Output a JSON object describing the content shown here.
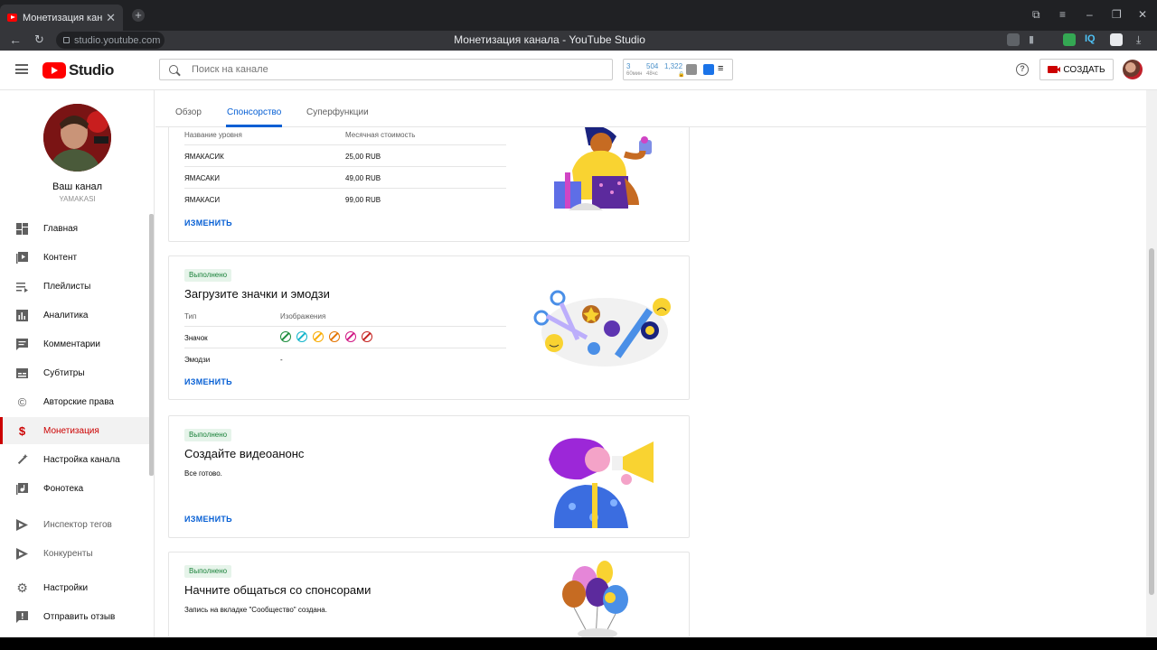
{
  "browser": {
    "tab_title": "Монетизация канала -",
    "page_title": "Монетизация канала - YouTube Studio",
    "url": "studio.youtube.com"
  },
  "header": {
    "logo_text": "Studio",
    "search_placeholder": "Поиск на канале",
    "stats": {
      "v1": "3",
      "l1": "60мин",
      "v2": "504",
      "l2": "48чс",
      "v3": "1,322"
    },
    "create_label": "СОЗДАТЬ"
  },
  "sidebar": {
    "channel_label": "Ваш канал",
    "channel_name": "YAMAKASI",
    "items": [
      {
        "label": "Главная",
        "icon": "dashboard-icon"
      },
      {
        "label": "Контент",
        "icon": "video-library-icon"
      },
      {
        "label": "Плейлисты",
        "icon": "playlist-icon"
      },
      {
        "label": "Аналитика",
        "icon": "analytics-icon"
      },
      {
        "label": "Комментарии",
        "icon": "comment-icon"
      },
      {
        "label": "Субтитры",
        "icon": "subtitles-icon"
      },
      {
        "label": "Авторские права",
        "icon": "copyright-icon"
      },
      {
        "label": "Монетизация",
        "icon": "dollar-icon"
      },
      {
        "label": "Настройка канала",
        "icon": "magic-wand-icon"
      },
      {
        "label": "Фонотека",
        "icon": "audio-library-icon"
      },
      {
        "label": "Инспектор тегов",
        "icon": "tag-inspector-icon"
      },
      {
        "label": "Конкуренты",
        "icon": "competitors-icon"
      },
      {
        "label": "Настройки",
        "icon": "gear-icon"
      },
      {
        "label": "Отправить отзыв",
        "icon": "feedback-icon"
      }
    ]
  },
  "tabs": [
    {
      "label": "Обзор"
    },
    {
      "label": "Спонсорство"
    },
    {
      "label": "Суперфункции"
    }
  ],
  "card_levels": {
    "col1": "Название уровня",
    "col2": "Месячная стоимость",
    "rows": [
      {
        "name": "ЯМАКАСИК",
        "price": "25,00 RUB"
      },
      {
        "name": "ЯМАСАКИ",
        "price": "49,00 RUB"
      },
      {
        "name": "ЯМАКАСИ",
        "price": "99,00 RUB"
      }
    ],
    "link": "ИЗМЕНИТЬ"
  },
  "card_badges": {
    "badge": "Выполнено",
    "title": "Загрузите значки и эмодзи",
    "col1": "Тип",
    "col2": "Изображения",
    "row1_label": "Значок",
    "row2_label": "Эмодзи",
    "row2_value": "-",
    "emoji_colors": [
      "#1e8e3e",
      "#12b5cb",
      "#f9ab00",
      "#e37400",
      "#d01884",
      "#c5221f"
    ],
    "link": "ИЗМЕНИТЬ"
  },
  "card_trailer": {
    "badge": "Выполнено",
    "title": "Создайте видеоанонс",
    "desc": "Все готово.",
    "link": "ИЗМЕНИТЬ"
  },
  "card_community": {
    "badge": "Выполнено",
    "title": "Начните общаться со спонсорами",
    "desc": "Запись на вкладке \"Сообщество\" создана."
  }
}
